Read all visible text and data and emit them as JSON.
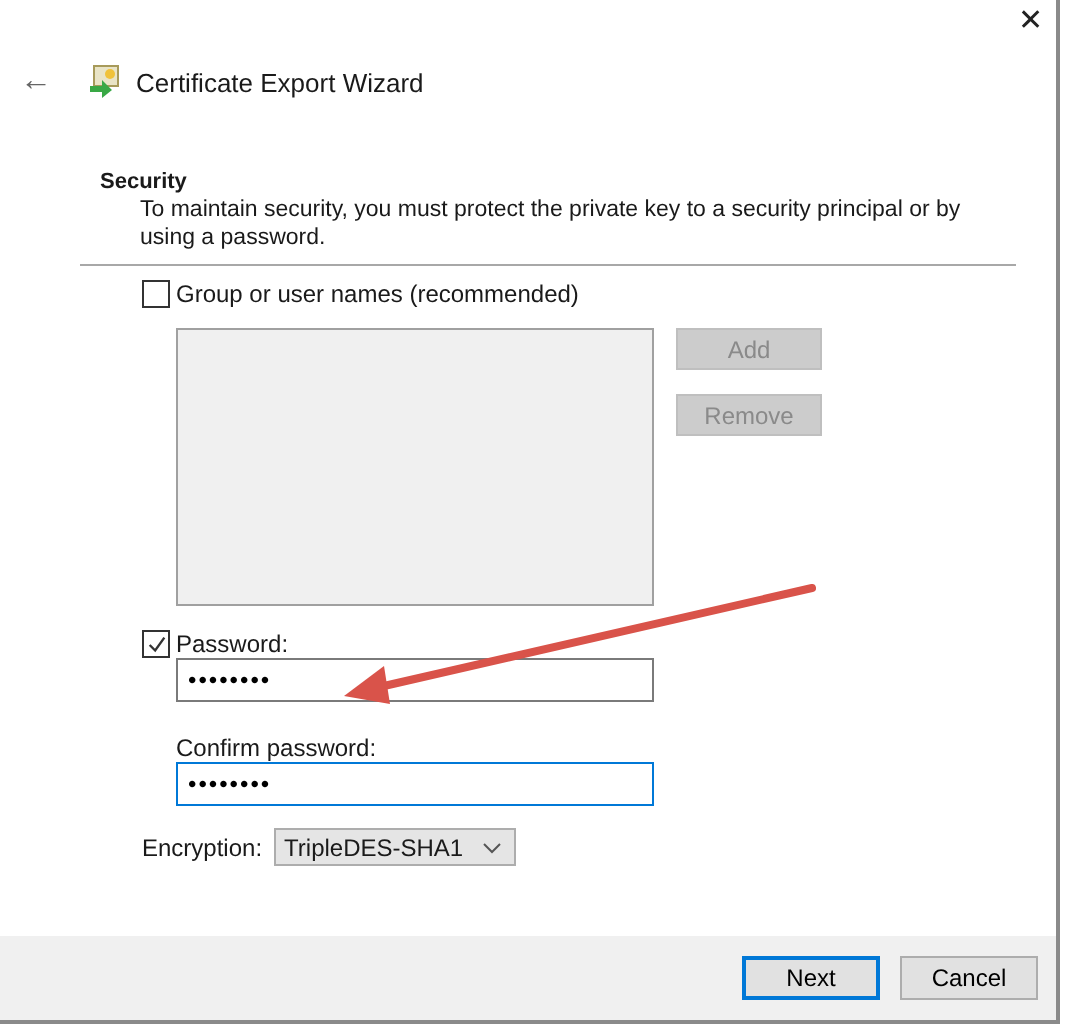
{
  "window": {
    "title": "Certificate Export Wizard",
    "close": "✕",
    "back": "←"
  },
  "section": {
    "heading": "Security",
    "description": "To maintain security, you must protect the private key to a security principal or by using a password."
  },
  "group_option": {
    "label": "Group or user names (recommended)",
    "checked": false
  },
  "side_buttons": [
    {
      "label": "Add",
      "disabled": true
    },
    {
      "label": "Remove",
      "disabled": true
    }
  ],
  "password_option": {
    "label": "Password:",
    "checked": true
  },
  "password": {
    "value": "••••••••",
    "focused": false
  },
  "confirm_label": "Confirm password:",
  "confirm_password": {
    "value": "••••••••",
    "focused": true
  },
  "encryption": {
    "label": "Encryption:",
    "value": "TripleDES-SHA1"
  },
  "footer_buttons": [
    {
      "label": "Next",
      "focused": true
    },
    {
      "label": "Cancel",
      "focused": false
    }
  ]
}
